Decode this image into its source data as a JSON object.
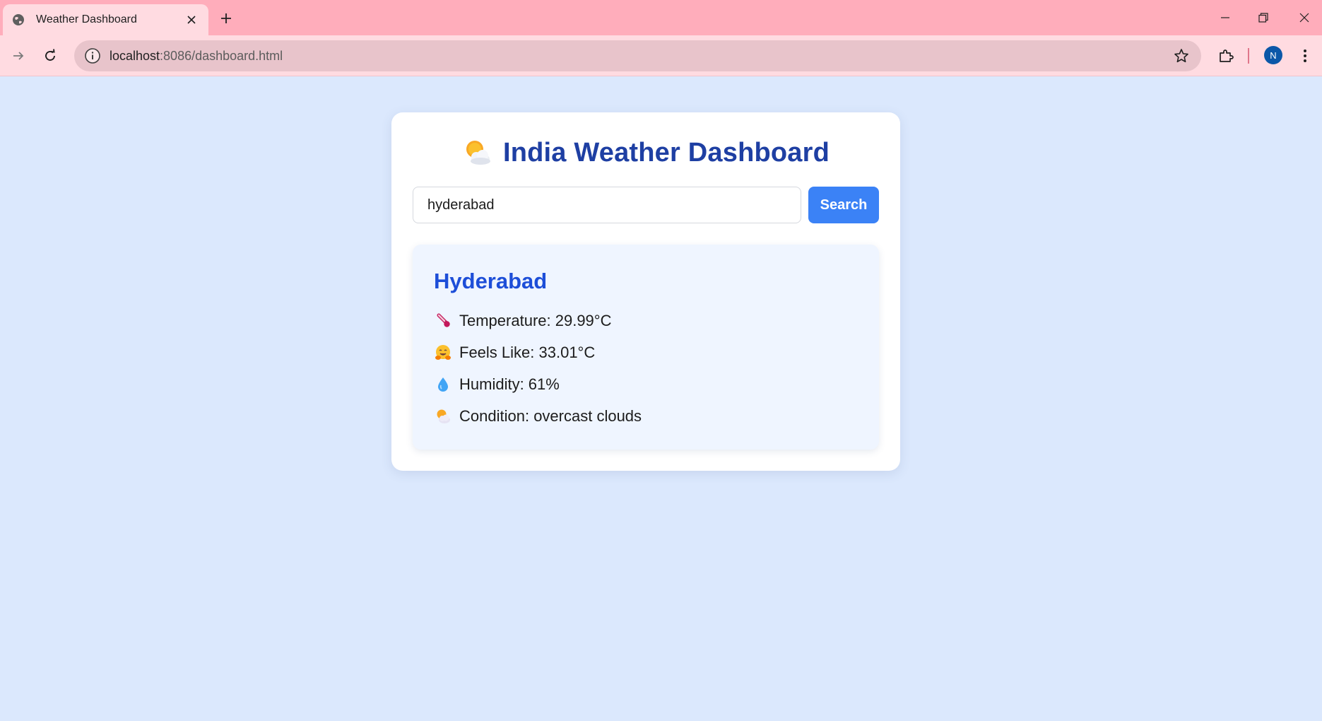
{
  "browser": {
    "tab_title": "Weather Dashboard",
    "url_host": "localhost",
    "url_rest": ":8086/dashboard.html",
    "profile_initial": "N"
  },
  "page": {
    "title": "India Weather Dashboard",
    "title_icon": "sun-behind-cloud-icon",
    "search": {
      "value": "hyderabad",
      "button_label": "Search"
    },
    "result": {
      "city": "Hyderabad",
      "details": [
        {
          "icon": "thermometer-icon",
          "label": "Temperature: ",
          "value": "29.99°C"
        },
        {
          "icon": "hugging-face-icon",
          "label": "Feels Like: ",
          "value": "33.01°C"
        },
        {
          "icon": "droplet-icon",
          "label": "Humidity: ",
          "value": "61%"
        },
        {
          "icon": "sun-behind-cloud-icon",
          "label": "Condition: ",
          "value": "overcast clouds"
        }
      ]
    }
  },
  "colors": {
    "page_bg": "#dbe8fd",
    "title": "#1e3fa3",
    "city": "#1d4ed8",
    "button": "#3b82f6",
    "panel_bg": "#eff5ff",
    "chrome_top": "#ffadbb",
    "chrome_toolbar": "#ffdbe1"
  }
}
